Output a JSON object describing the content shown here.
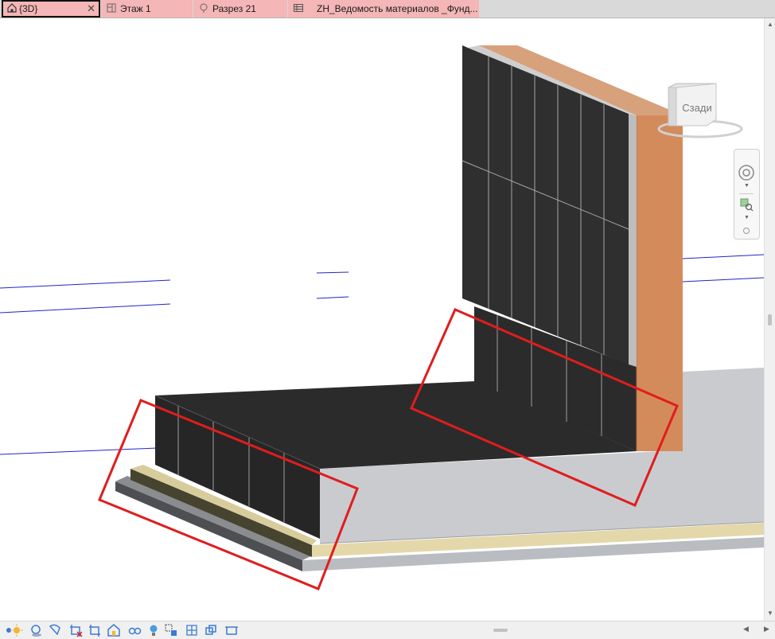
{
  "tabs": [
    {
      "label": "{3D}",
      "icon": "home-3d-icon",
      "active": true
    },
    {
      "label": "Этаж 1",
      "icon": "floor-plan-icon",
      "active": false
    },
    {
      "label": "Разрез 21",
      "icon": "section-icon",
      "active": false
    },
    {
      "label": "ZH_Ведомость материалов _Фунд...",
      "icon": "schedule-table-icon",
      "active": false
    }
  ],
  "viewcube": {
    "face_label": "Сзади"
  },
  "colors": {
    "tab_background": "#f4b6b6",
    "wall_tiles": "#2e2e2e",
    "brick_face": "#d18a5c",
    "slab": "#c8cacd",
    "sand_layer": "#e3d6a8",
    "highlight_box": "#e02020",
    "grid_line": "#2020c8"
  },
  "view_controls": [
    "scale-icon",
    "sun-path-icon",
    "shadows-icon",
    "crop-view-icon",
    "show-crop-icon",
    "lock-3d-view-icon",
    "temporary-hide-icon",
    "reveal-hidden-icon",
    "light-bulb-icon",
    "analytical-model-icon",
    "highlight-displacement-icon",
    "worksharing-icon",
    "reveal-constraints-icon",
    "temporary-view-props-icon"
  ]
}
